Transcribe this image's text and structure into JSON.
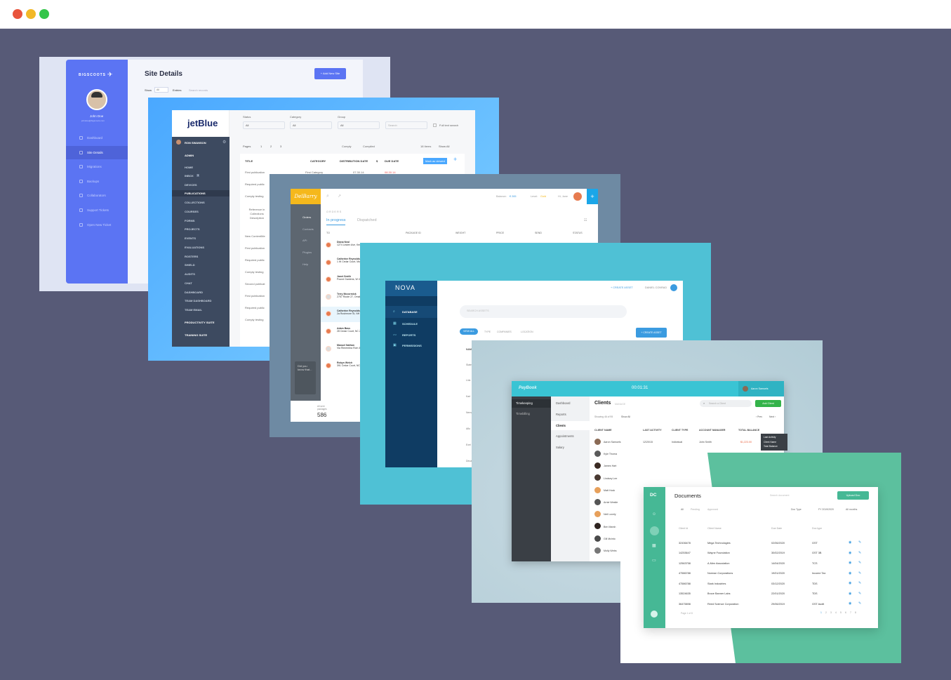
{
  "window": {
    "close_color": "#e8543c",
    "min_color": "#f2b827",
    "max_color": "#34c54a"
  },
  "panel1": {
    "brand": "BIGSCOOTS",
    "user_name": "John Doe",
    "user_email": "johndoe@bigscoots.com",
    "nav": [
      "Dashboard",
      "Site Details",
      "Migrations",
      "Backups",
      "Collaborators",
      "Support Tickets",
      "Open New Ticket"
    ],
    "title": "Site Details",
    "add_button": "+ Add New Site",
    "show_label": "Show",
    "show_value": "All",
    "entries_label": "Entries",
    "search_placeholder": "Search records"
  },
  "panel2": {
    "logo": "jetBlue",
    "user": "RON SWANSON",
    "filters": [
      {
        "label": "Status",
        "value": "All"
      },
      {
        "label": "Category",
        "value": "All"
      },
      {
        "label": "Group",
        "value": "All"
      }
    ],
    "search_placeholder": "Search",
    "full_text": "Full text search",
    "admin_label": "ADMIN",
    "nav": [
      "HOME",
      "INBOX",
      "DEVICES",
      "PUBLICATIONS",
      "COLLECTIONS",
      "COURSES",
      "FORMS",
      "PROJECTS",
      "EVENTS",
      "EVALUATIONS",
      "ROSTERS",
      "SHIELD",
      "AUDITS",
      "CHAT",
      "DASHBOARD",
      "TEAM DASHBOARD",
      "TEAM EMAIL"
    ],
    "inbox_count": "3",
    "suites": [
      "PRODUCTIVITY SUITE",
      "TRAINING SUITE"
    ],
    "pages_label": "Pages",
    "pages": [
      "1",
      "2",
      "3"
    ],
    "legend": [
      "Comply",
      "Compiled"
    ],
    "items": "18 Items",
    "show_all": "Show All",
    "columns": [
      "TITLE",
      "CATEGORY",
      "DISTRIBUTION DATE",
      "$",
      "DUE DATE"
    ],
    "rows": [
      "First publication",
      "Required public",
      "Comply testing",
      "Reference in Collections Description",
      "New ContentMe",
      "First publication",
      "Required public",
      "Comply testing",
      "Second publicat",
      "First publication",
      "Required public",
      "Comply testing"
    ],
    "first_cat": "First Category",
    "first_date": "07.30.14",
    "first_due": "08.30.14",
    "tooltip": "Mark as viewed"
  },
  "panel3": {
    "logo": "DelBarry",
    "balance_label": "Balance:",
    "balance": "€ 265",
    "level_label": "Level:",
    "level": "Gold",
    "greeting": "Hi, Jane",
    "nav": [
      "Orders",
      "Contacts",
      "API",
      "Plugins",
      "Help"
    ],
    "section": "ORDERS",
    "tabs": [
      "In progress",
      "Dispatched"
    ],
    "columns": [
      "TO",
      "PACKAGE ID",
      "WEIGHT",
      "PRICE",
      "SEND",
      "STATUS"
    ],
    "orders": [
      {
        "name": "Diana Neal",
        "addr": "1274 Linden Ave, Kent, OH 44240 US"
      },
      {
        "name": "Catherine Reynolds",
        "addr": "1 W Cedar Court, Monticello, NC 27"
      },
      {
        "name": "Janet Smith",
        "addr": "Pound Gardens, W 47008 Burrows N"
      },
      {
        "name": "Terry Mccormick",
        "addr": "2757 Route 27, Omaha, NM 53320"
      },
      {
        "name": "Catherine Reynolds",
        "addr": "2a Rushmore St, NH 1B, Pittra, CI"
      },
      {
        "name": "Adam Bass",
        "addr": "28 Cedar Court, NC 27828, UK"
      },
      {
        "name": "Manuel Nathan",
        "addr": "Via Rimembra Rom 44001 Cordena Ch"
      },
      {
        "name": "Robyn Welch",
        "addr": "391 Cedar Court, NC 27828, UK"
      }
    ],
    "tip": "Did you know that...",
    "packages_label": "All sent packages",
    "packages": "586"
  },
  "panel4": {
    "logo": "NOVA",
    "create_link": "+ CREATE ASSET",
    "user": "DANIEL CONRAD",
    "nav": [
      "DATABASE",
      "SCHEDULE",
      "REPORTS",
      "PERMISSIONS"
    ],
    "search_placeholder": "SEARCH ASSETS",
    "filters": [
      "VIEW ALL",
      "TYPE",
      "COMPANIES",
      "LOCATION"
    ],
    "create_button": "+ CREATE ASSET",
    "col": "NAME",
    "rows": [
      "Slate",
      "Link",
      "Karl",
      "Nema",
      "Aflo",
      "Exel",
      "Deca"
    ]
  },
  "panel5": {
    "logo": "PayBook",
    "timer": "00:01:31",
    "user": "Aaron Samuels",
    "nav1": [
      "Timekeeping",
      "Timebilling"
    ],
    "nav2": [
      "Dashboard",
      "Reports",
      "Clients",
      "Appointments",
      "Salary"
    ],
    "title": "Clients",
    "subtitle": "MANAGE",
    "search_placeholder": "Search a Client",
    "add_button": "Add Client",
    "showing": "Showing 46 of 95",
    "show_filter": "Show All",
    "prev": "‹ Prev",
    "next": "Next ›",
    "columns": [
      "CLIENT NAME",
      "LAST ACTIVITY",
      "CLIENT TYPE",
      "ACCOUNT MANAGER",
      "TOTAL BALANCE"
    ],
    "first_row": {
      "name": "Aaron Samuels",
      "date": "12/20/15",
      "type": "Individual",
      "manager": "John Smith",
      "balance": "$1,223.00"
    },
    "names": [
      "Kyle Thoma",
      "James Hart",
      "Lindsey Lee",
      "Matt Hock",
      "Arnie Westle",
      "Neil Lovely",
      "Ben Marsh",
      "Gill Mcinto",
      "Molly Webs"
    ],
    "menu": [
      "Last Activity",
      "Client Name",
      "Total Balance"
    ]
  },
  "panel6": {
    "logo": "DC",
    "title": "Documents",
    "search_placeholder": "Search document",
    "upload": "Upload Doc",
    "tabs": [
      "All",
      "Pending",
      "Approved"
    ],
    "selects": [
      "Doc Type",
      "FY 2019/2020",
      "All months"
    ],
    "columns": [
      "Client Id",
      "Client Name",
      "Due Date",
      "Doc type"
    ],
    "rows": [
      [
        "32436478",
        "Mega Technologies",
        "02/06/2020",
        "GST"
      ],
      [
        "14253647",
        "Wayne Foundation",
        "30/02/2019",
        "GST 3B"
      ],
      [
        "12563758",
        "A-Men Association",
        "14/04/2020",
        "TCS"
      ],
      [
        "47586788",
        "Norman Corporations",
        "19/01/2020",
        "Income Tax"
      ],
      [
        "47586788",
        "Stark Industries",
        "03/12/2020",
        "TDS"
      ],
      [
        "13524635",
        "Bruce Banner Labs",
        "22/01/2020",
        "TDS"
      ],
      [
        "36475898",
        "Reed Science Corporation",
        "29/06/2019",
        "GST Audit"
      ]
    ],
    "page_info": "Page 1 of 8",
    "pages": [
      "1",
      "2",
      "3",
      "4",
      "5",
      "6",
      "7",
      "8"
    ]
  }
}
